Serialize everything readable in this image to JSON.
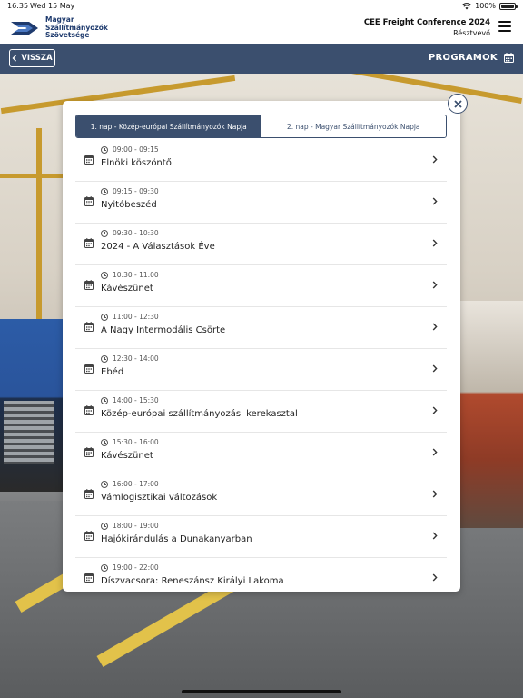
{
  "status_bar": {
    "time": "16:35",
    "date": "Wed 15 May",
    "battery": "100%"
  },
  "header": {
    "logo_lines": [
      "Magyar",
      "Szállítmányozók",
      "Szövetsége"
    ],
    "conference": "CEE Freight Conference 2024",
    "role": "Résztvevő"
  },
  "nav": {
    "back_label": "VISSZA",
    "title": "PROGRAMOK"
  },
  "tabs": [
    {
      "label": "1. nap - Közép-európai Szállítmányozók Napja",
      "active": true
    },
    {
      "label": "2. nap - Magyar Szállítmányozók Napja",
      "active": false
    }
  ],
  "program": [
    {
      "time": "09:00 - 09:15",
      "title": "Elnöki köszöntő"
    },
    {
      "time": "09:15 - 09:30",
      "title": "Nyitóbeszéd"
    },
    {
      "time": "09:30 - 10:30",
      "title": "2024 - A Választások Éve"
    },
    {
      "time": "10:30 - 11:00",
      "title": "Kávészünet"
    },
    {
      "time": "11:00 - 12:30",
      "title": "A Nagy Intermodális Csörte"
    },
    {
      "time": "12:30 - 14:00",
      "title": "Ebéd"
    },
    {
      "time": "14:00 - 15:30",
      "title": "Közép-európai szállítmányozási kerekasztal"
    },
    {
      "time": "15:30 - 16:00",
      "title": "Kávészünet"
    },
    {
      "time": "16:00 - 17:00",
      "title": "Vámlogisztikai változások"
    },
    {
      "time": "18:00 - 19:00",
      "title": "Hajókirándulás a Dunakanyarban"
    },
    {
      "time": "19:00 - 22:00",
      "title": "Díszvacsora: Reneszánsz Királyi Lakoma"
    }
  ],
  "colors": {
    "primary": "#3b4f6e",
    "text": "#222222"
  },
  "icons": {
    "close": "close-icon",
    "calendar": "calendar-icon",
    "clock": "clock-icon",
    "chevron": "chevron-right-icon"
  }
}
